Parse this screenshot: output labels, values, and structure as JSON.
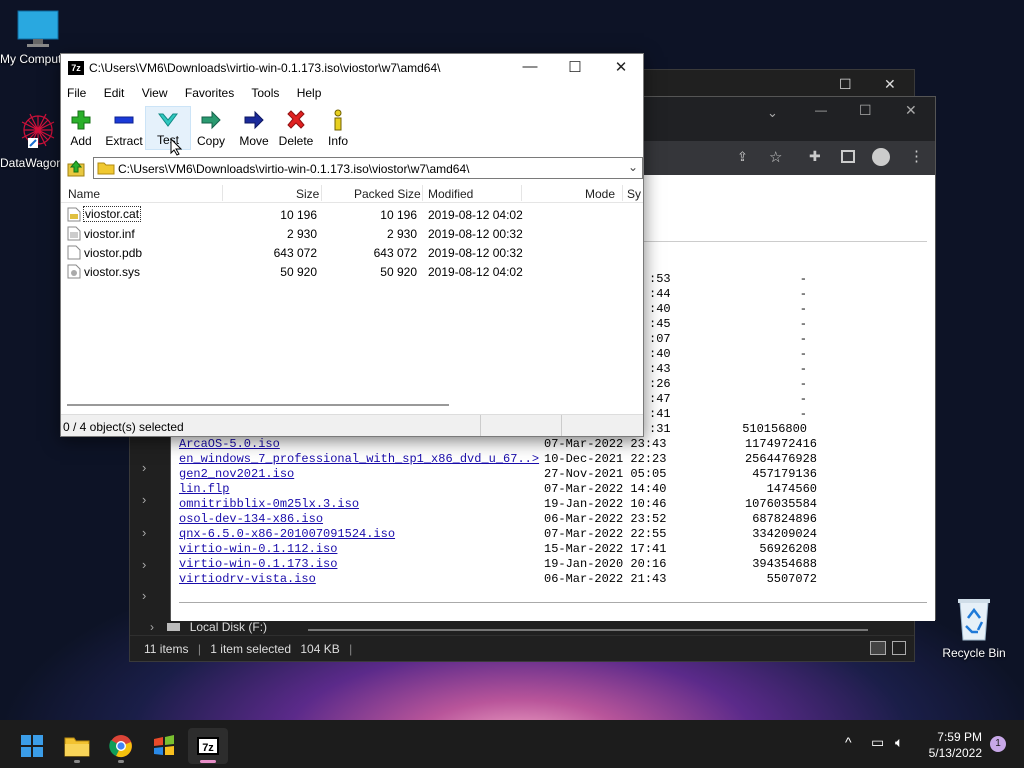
{
  "desktop": {
    "icons": [
      {
        "label": "My Computer"
      },
      {
        "label": "DataWagon"
      },
      {
        "label": "Recycle Bin"
      }
    ]
  },
  "explorer": {
    "drive_label": "Local Disk (F:)",
    "status": {
      "count": "11 items",
      "selected": "1 item selected",
      "size": "104 KB"
    }
  },
  "chrome": {
    "partial_rows": [
      {
        "time": ":53",
        "size": "-"
      },
      {
        "time": ":44",
        "size": "-"
      },
      {
        "time": ":40",
        "size": "-"
      },
      {
        "time": ":45",
        "size": "-"
      },
      {
        "time": ":07",
        "size": "-"
      },
      {
        "time": ":40",
        "size": "-"
      },
      {
        "time": ":43",
        "size": "-"
      },
      {
        "time": ":26",
        "size": "-"
      },
      {
        "time": ":47",
        "size": "-"
      },
      {
        "time": ":41",
        "size": "-"
      },
      {
        "time": ":31",
        "size": "510156800"
      }
    ],
    "files": [
      {
        "name": "ArcaOS-5.0.iso",
        "date": "07-Mar-2022 23:43",
        "size": "1174972416"
      },
      {
        "name": "en_windows_7_professional_with_sp1_x86_dvd_u_67..>",
        "date": "10-Dec-2021 22:23",
        "size": "2564476928"
      },
      {
        "name": "gen2_nov2021.iso",
        "date": "27-Nov-2021 05:05",
        "size": "457179136"
      },
      {
        "name": "lin.flp",
        "date": "07-Mar-2022 14:40",
        "size": "1474560"
      },
      {
        "name": "omnitribblix-0m25lx.3.iso",
        "date": "19-Jan-2022 10:46",
        "size": "1076035584"
      },
      {
        "name": "osol-dev-134-x86.iso",
        "date": "06-Mar-2022 23:52",
        "size": "687824896"
      },
      {
        "name": "qnx-6.5.0-x86-201007091524.iso",
        "date": "07-Mar-2022 22:55",
        "size": "334209024"
      },
      {
        "name": "virtio-win-0.1.112.iso",
        "date": "15-Mar-2022 17:41",
        "size": "56926208"
      },
      {
        "name": "virtio-win-0.1.173.iso",
        "date": "19-Jan-2020 20:16",
        "size": "394354688"
      },
      {
        "name": "virtiodrv-vista.iso",
        "date": "06-Mar-2022 21:43",
        "size": "5507072"
      }
    ]
  },
  "sevenzip": {
    "title": "C:\\Users\\VM6\\Downloads\\virtio-win-0.1.173.iso\\viostor\\w7\\amd64\\",
    "app_badge": "7z",
    "menu": [
      "File",
      "Edit",
      "View",
      "Favorites",
      "Tools",
      "Help"
    ],
    "toolbar": [
      {
        "label": "Add",
        "icon": "plus-icon"
      },
      {
        "label": "Extract",
        "icon": "minus-icon"
      },
      {
        "label": "Test",
        "icon": "check-icon"
      },
      {
        "label": "Copy",
        "icon": "copy-arrow-icon"
      },
      {
        "label": "Move",
        "icon": "move-arrow-icon"
      },
      {
        "label": "Delete",
        "icon": "delete-x-icon"
      },
      {
        "label": "Info",
        "icon": "info-icon"
      }
    ],
    "address": "C:\\Users\\VM6\\Downloads\\virtio-win-0.1.173.iso\\viostor\\w7\\amd64\\",
    "columns": {
      "name": "Name",
      "size": "Size",
      "packed": "Packed Size",
      "modified": "Modified",
      "mode": "Mode",
      "sys": "Sy"
    },
    "files": [
      {
        "name": "viostor.cat",
        "size": "10 196",
        "packed": "10 196",
        "modified": "2019-08-12 04:02"
      },
      {
        "name": "viostor.inf",
        "size": "2 930",
        "packed": "2 930",
        "modified": "2019-08-12 00:32"
      },
      {
        "name": "viostor.pdb",
        "size": "643 072",
        "packed": "643 072",
        "modified": "2019-08-12 00:32"
      },
      {
        "name": "viostor.sys",
        "size": "50 920",
        "packed": "50 920",
        "modified": "2019-08-12 04:02"
      }
    ],
    "status": "0 / 4 object(s) selected"
  },
  "taskbar": {
    "time": "7:59 PM",
    "date": "5/13/2022",
    "notifications": "1",
    "app_badge": "7z"
  },
  "colors": {
    "link": "#1a0dab",
    "accent": "#e88fc8"
  }
}
